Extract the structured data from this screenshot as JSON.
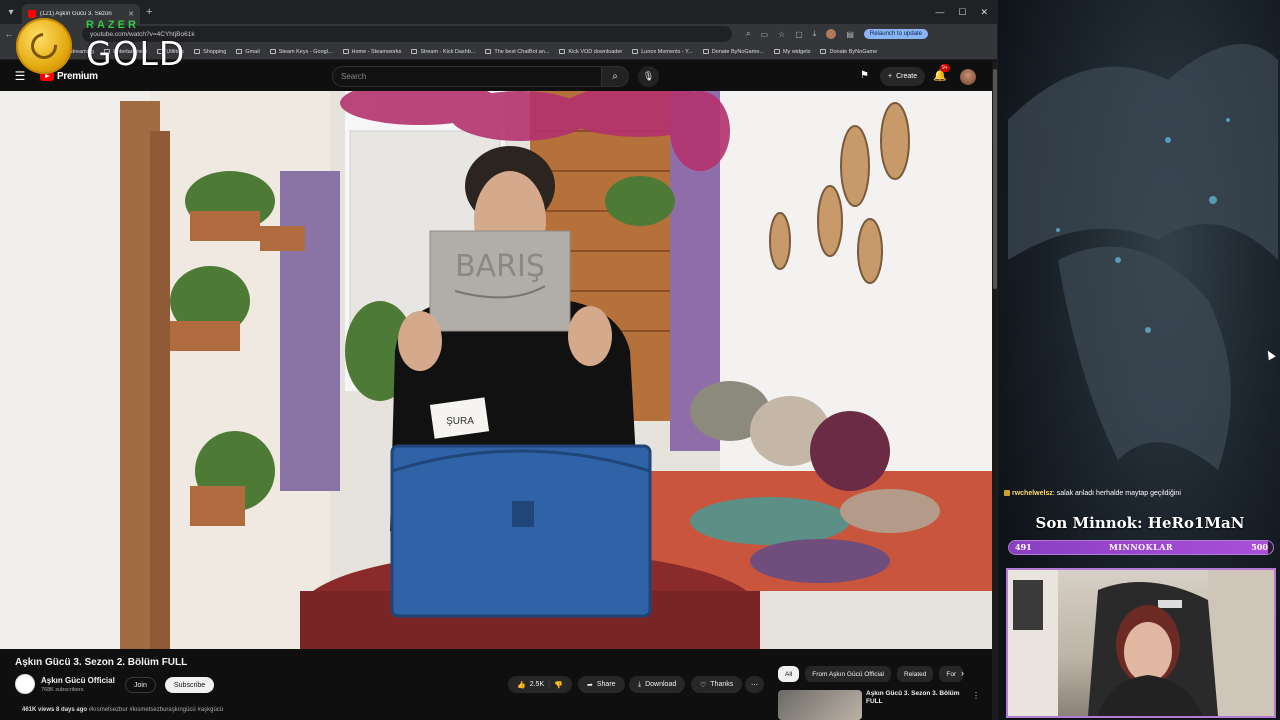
{
  "browser": {
    "tab_title": "(121) Aşkın Gücü 3. Sezon",
    "url": "youtube.com/watch?v=4CYhtjBo61k",
    "relaunch_label": "Relaunch to update",
    "bookmarks": [
      "Streaming",
      "Entertainment",
      "Utilities",
      "Shopping",
      "Gmail",
      "Steam Keys - Googl...",
      "Home - Steamworks",
      "Stream - Kick Dashb...",
      "The best ChatBot an...",
      "Kick VOD downloader",
      "Lunox Moments - Y...",
      "Donate ByNoGame...",
      "My widgets",
      "Donate ByNoGame"
    ]
  },
  "razer_overlay": {
    "brand": "RAZER",
    "tier": "GOLD"
  },
  "youtube": {
    "logo_text": "Premium",
    "search_placeholder": "Search",
    "create_label": "Create",
    "notification_count": "9+",
    "video_title": "Aşkın Gücü 3. Sezon 2. Bölüm FULL",
    "channel_name": "Aşkın Gücü Official",
    "subscribers": "768K subscribers",
    "join_label": "Join",
    "subscribe_label": "Subscribe",
    "likes": "2.5K",
    "share_label": "Share",
    "download_label": "Download",
    "thanks_label": "Thanks",
    "views_text": "461K views",
    "date_text": "8 days ago",
    "hashtags": "#kısmetsezbur #kısmetsezburaşkıngücü #aşkgücü",
    "chips": [
      "All",
      "From Aşkın Gücü Official",
      "Related",
      "For"
    ],
    "recommended_title": "Aşkın Gücü 3. Sezon 3. Bölüm FULL"
  },
  "video_scene": {
    "card_text": "BARIŞ",
    "name_tag": "ŞURA"
  },
  "stream_overlay": {
    "chat_user": "rwchelwelsz",
    "chat_message": ": salak anladı herhalde maytap geçildiğini",
    "last_donor_label": "Son Minnok: HeRo1MaN",
    "goal_label": "MINNOKLAR",
    "goal_current": "491",
    "goal_target": "500",
    "goal_fraction": 0.982
  },
  "colors": {
    "youtube_red": "#ff0000",
    "razer_green": "#2ecc40",
    "goal_purple": "#a950d8",
    "frame_purple": "#b37ad6"
  }
}
